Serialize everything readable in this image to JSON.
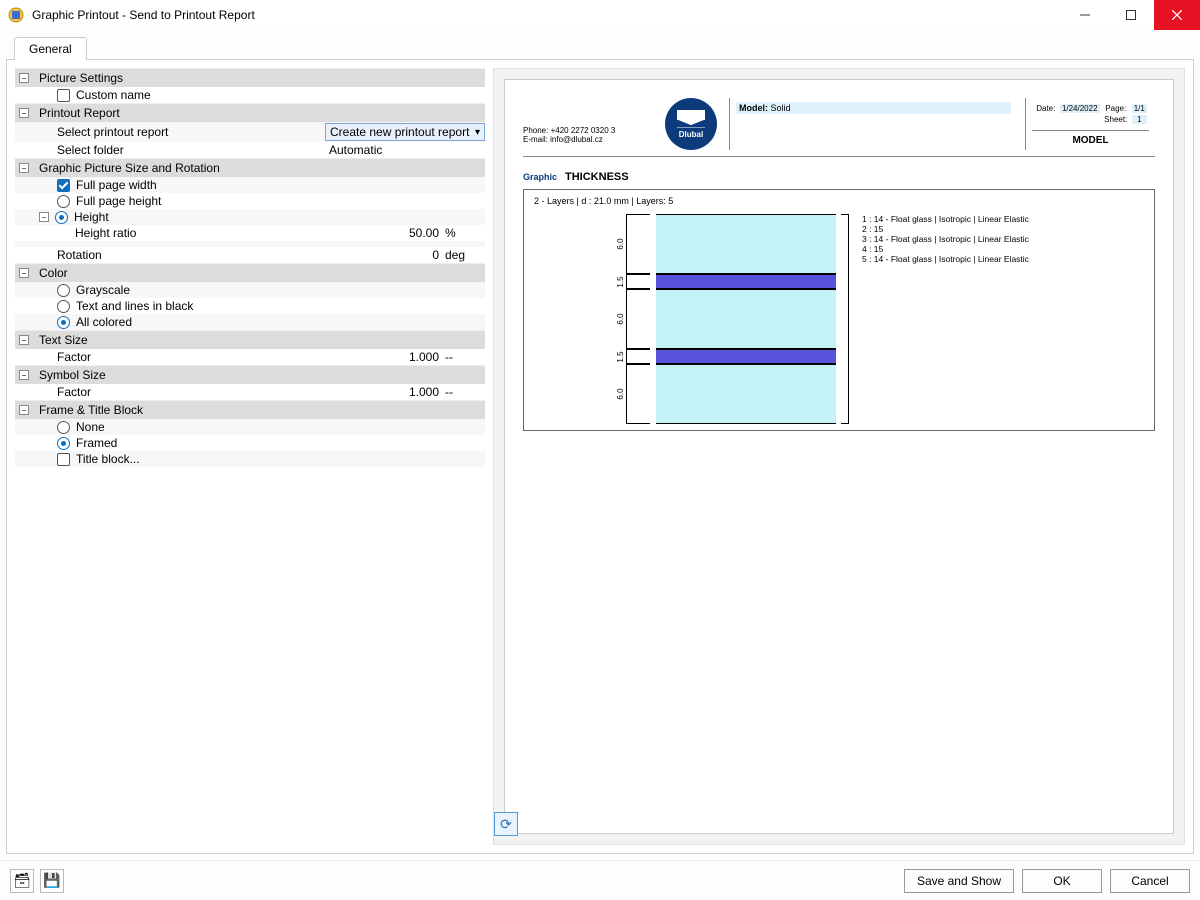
{
  "window": {
    "title": "Graphic Printout - Send to Printout Report"
  },
  "tabs": {
    "general": "General"
  },
  "sections": {
    "picture_settings": "Picture Settings",
    "custom_name": "Custom name",
    "printout_report": "Printout Report",
    "select_printout_report": "Select printout report",
    "printout_report_value": "Create new printout report",
    "select_folder": "Select folder",
    "select_folder_value": "Automatic",
    "size_rotation": "Graphic Picture Size and Rotation",
    "full_page_width": "Full page width",
    "full_page_height": "Full page height",
    "height": "Height",
    "height_ratio": "Height ratio",
    "height_ratio_value": "50.00",
    "height_ratio_unit": "%",
    "rotation": "Rotation",
    "rotation_value": "0",
    "rotation_unit": "deg",
    "color": "Color",
    "grayscale": "Grayscale",
    "text_lines_black": "Text and lines in black",
    "all_colored": "All colored",
    "text_size": "Text Size",
    "factor": "Factor",
    "text_factor_value": "1.000",
    "text_factor_unit": "--",
    "symbol_size": "Symbol Size",
    "symbol_factor_value": "1.000",
    "symbol_factor_unit": "--",
    "frame": "Frame & Title Block",
    "none": "None",
    "framed": "Framed",
    "title_block": "Title block..."
  },
  "preview": {
    "phone": "Phone: +420 2272 0320 3",
    "email": "E-mail: info@dlubal.cz",
    "logo_text": "Dlubal",
    "model_label": "Model:",
    "model_value": "Solid",
    "date_label": "Date:",
    "date_value": "1/24/2022",
    "page_label": "Page:",
    "page_value": "1/1",
    "sheet_label": "Sheet:",
    "sheet_value": "1",
    "model_big": "MODEL",
    "graphic_label": "Graphic",
    "thickness": "THICKNESS",
    "subtitle": "2 - Layers | d : 21.0 mm | Layers: 5",
    "legend": [
      "1 : 14 - Float glass | Isotropic | Linear Elastic",
      "2 : 15",
      "3 : 14 - Float glass | Isotropic | Linear Elastic",
      "4 : 15",
      "5 : 14 - Float glass | Isotropic | Linear Elastic"
    ],
    "dims": [
      "6.0",
      "1.5",
      "6.0",
      "1.5",
      "6.0"
    ]
  },
  "footer": {
    "save_and_show": "Save and Show",
    "ok": "OK",
    "cancel": "Cancel"
  }
}
